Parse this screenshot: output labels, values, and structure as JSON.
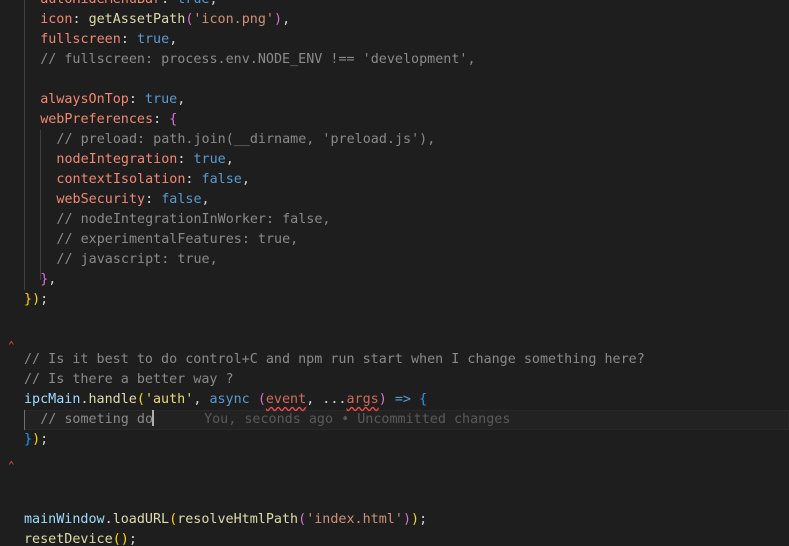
{
  "editor": {
    "lines": [
      {
        "indent": 2,
        "tokens": [
          [
            "prop",
            "autoHideMenuBar"
          ],
          [
            "pun",
            ": "
          ],
          [
            "kw",
            "true"
          ],
          [
            "pun",
            ","
          ]
        ]
      },
      {
        "indent": 2,
        "tokens": [
          [
            "prop",
            "icon"
          ],
          [
            "pun",
            ": "
          ],
          [
            "fn",
            "getAssetPath"
          ],
          [
            "br2",
            "("
          ],
          [
            "str",
            "'icon.png'"
          ],
          [
            "br2",
            ")"
          ],
          [
            "pun",
            ","
          ]
        ]
      },
      {
        "indent": 2,
        "tokens": [
          [
            "prop",
            "fullscreen"
          ],
          [
            "pun",
            ": "
          ],
          [
            "kw",
            "true"
          ],
          [
            "pun",
            ","
          ]
        ]
      },
      {
        "indent": 2,
        "tokens": [
          [
            "cmg",
            "// fullscreen: process.env.NODE_ENV !== 'development',"
          ]
        ]
      },
      {
        "indent": 0,
        "tokens": []
      },
      {
        "indent": 2,
        "tokens": [
          [
            "prop",
            "alwaysOnTop"
          ],
          [
            "pun",
            ": "
          ],
          [
            "kw",
            "true"
          ],
          [
            "pun",
            ","
          ]
        ]
      },
      {
        "indent": 2,
        "tokens": [
          [
            "prop",
            "webPreferences"
          ],
          [
            "pun",
            ": "
          ],
          [
            "br2",
            "{"
          ]
        ]
      },
      {
        "indent": 4,
        "tokens": [
          [
            "cmg",
            "// preload: path.join(__dirname, 'preload.js'),"
          ]
        ]
      },
      {
        "indent": 4,
        "tokens": [
          [
            "prop",
            "nodeIntegration"
          ],
          [
            "pun",
            ": "
          ],
          [
            "kw",
            "true"
          ],
          [
            "pun",
            ","
          ]
        ]
      },
      {
        "indent": 4,
        "tokens": [
          [
            "prop",
            "contextIsolation"
          ],
          [
            "pun",
            ": "
          ],
          [
            "kw",
            "false"
          ],
          [
            "pun",
            ","
          ]
        ]
      },
      {
        "indent": 4,
        "tokens": [
          [
            "prop",
            "webSecurity"
          ],
          [
            "pun",
            ": "
          ],
          [
            "kw",
            "false"
          ],
          [
            "pun",
            ","
          ]
        ]
      },
      {
        "indent": 4,
        "tokens": [
          [
            "cmg",
            "// nodeIntegrationInWorker: false,"
          ]
        ]
      },
      {
        "indent": 4,
        "tokens": [
          [
            "cmg",
            "// experimentalFeatures: true,"
          ]
        ]
      },
      {
        "indent": 4,
        "tokens": [
          [
            "cmg",
            "// javascript: true,"
          ]
        ]
      },
      {
        "indent": 2,
        "tokens": [
          [
            "br2",
            "}"
          ],
          [
            "pun",
            ","
          ]
        ]
      },
      {
        "indent": 0,
        "tokens": [
          [
            "br1",
            "}"
          ],
          [
            "br1",
            ")"
          ],
          [
            "pun",
            ";"
          ]
        ]
      },
      {
        "indent": 0,
        "tokens": []
      },
      {
        "indent": 0,
        "tokens": []
      },
      {
        "indent": 0,
        "tokens": [
          [
            "cmg",
            "// Is it best to do control+C and npm run start when I change something here?"
          ]
        ]
      },
      {
        "indent": 0,
        "tokens": [
          [
            "cmg",
            "// Is there a better way ?"
          ]
        ]
      },
      {
        "indent": 0,
        "tokens": [
          [
            "var",
            "ipcMain"
          ],
          [
            "pun",
            "."
          ],
          [
            "fn",
            "handle"
          ],
          [
            "br1",
            "("
          ],
          [
            "str2",
            "'auth'"
          ],
          [
            "pun",
            ", "
          ],
          [
            "kw",
            "async "
          ],
          [
            "br2",
            "("
          ],
          [
            "parerr",
            "event"
          ],
          [
            "pun",
            ", ..."
          ],
          [
            "parerr",
            "args"
          ],
          [
            "br2",
            ")"
          ],
          [
            "kw",
            " => "
          ],
          [
            "br3",
            "{"
          ]
        ]
      },
      {
        "indent": 2,
        "tokens": [
          [
            "cmg",
            "// someting do"
          ]
        ],
        "cursor": true,
        "blame": "You, seconds ago • Uncommitted changes"
      },
      {
        "indent": 0,
        "tokens": [
          [
            "br3",
            "}"
          ],
          [
            "br1",
            ")"
          ],
          [
            "pun",
            ";"
          ]
        ]
      },
      {
        "indent": 0,
        "tokens": []
      },
      {
        "indent": 0,
        "tokens": []
      },
      {
        "indent": 0,
        "tokens": []
      },
      {
        "indent": 0,
        "tokens": [
          [
            "var",
            "mainWindow"
          ],
          [
            "pun",
            "."
          ],
          [
            "fn",
            "loadURL"
          ],
          [
            "br1",
            "("
          ],
          [
            "fn",
            "resolveHtmlPath"
          ],
          [
            "br2",
            "("
          ],
          [
            "str",
            "'index.html'"
          ],
          [
            "br2",
            ")"
          ],
          [
            "br1",
            ")"
          ],
          [
            "pun",
            ";"
          ]
        ]
      },
      {
        "indent": 0,
        "tokens": [
          [
            "fn",
            "resetDevice"
          ],
          [
            "br1",
            "("
          ],
          [
            "br1",
            ")"
          ],
          [
            "pun",
            ";"
          ]
        ]
      }
    ]
  },
  "colors": {
    "background": "#1e1e1e",
    "property": "#f48771",
    "keyword": "#569cd6",
    "function": "#dcdcaa",
    "string": "#ce9178",
    "comment": "#8a8a8a"
  }
}
